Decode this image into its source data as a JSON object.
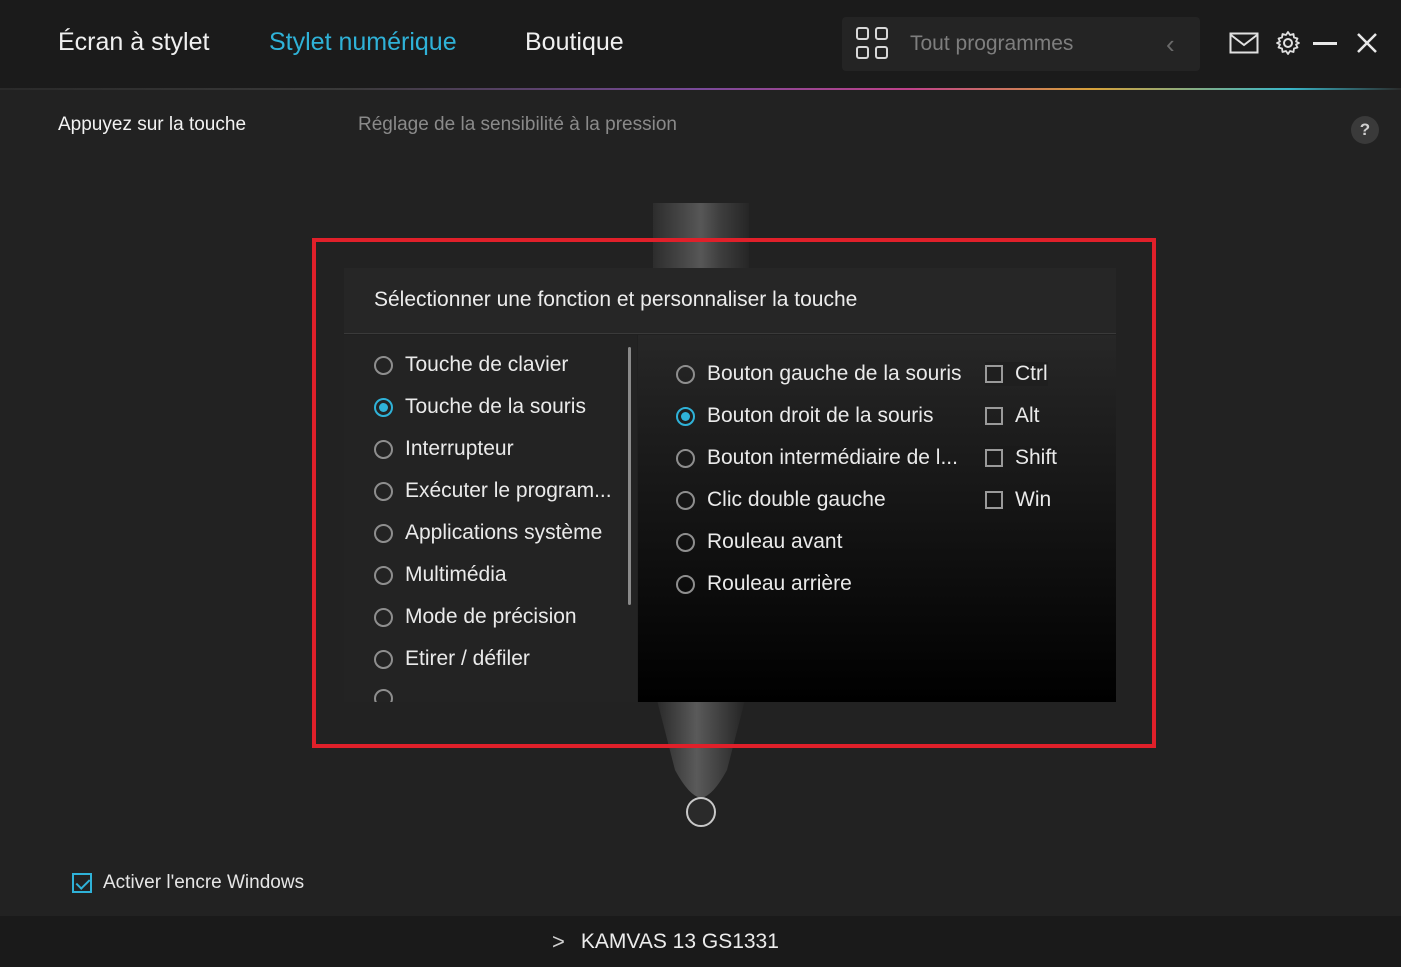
{
  "header": {
    "tabs": [
      {
        "label": "Écran à stylet",
        "active": false
      },
      {
        "label": "Stylet numérique",
        "active": true
      },
      {
        "label": "Boutique",
        "active": false
      }
    ],
    "program_selector": {
      "label": "Tout programmes",
      "icon": "grid-icon"
    },
    "window_icons": [
      "mail-icon",
      "gear-icon",
      "minimize-icon",
      "close-icon"
    ],
    "accent_color": "#2fb2d8"
  },
  "subtabs": {
    "active": "Appuyez sur la touche",
    "inactive": "Réglage de la sensibilité à la pression",
    "help": "?"
  },
  "panel": {
    "title": "Sélectionner une fonction et personnaliser la touche",
    "categories": [
      {
        "label": "Touche de clavier",
        "selected": false
      },
      {
        "label": "Touche de la souris",
        "selected": true
      },
      {
        "label": "Interrupteur",
        "selected": false
      },
      {
        "label": "Exécuter le program...",
        "selected": false
      },
      {
        "label": "Applications système",
        "selected": false
      },
      {
        "label": "Multimédia",
        "selected": false
      },
      {
        "label": "Mode de précision",
        "selected": false
      },
      {
        "label": "Etirer / défiler",
        "selected": false
      }
    ],
    "mouse_functions": [
      {
        "label": "Bouton gauche de la souris",
        "selected": false
      },
      {
        "label": "Bouton droit de la souris",
        "selected": true
      },
      {
        "label": "Bouton intermédiaire de l...",
        "selected": false
      },
      {
        "label": "Clic double gauche",
        "selected": false
      },
      {
        "label": "Rouleau avant",
        "selected": false
      },
      {
        "label": "Rouleau arrière",
        "selected": false
      }
    ],
    "modifiers": [
      {
        "label": "Ctrl",
        "checked": false
      },
      {
        "label": "Alt",
        "checked": false
      },
      {
        "label": "Shift",
        "checked": false
      },
      {
        "label": "Win",
        "checked": false
      }
    ]
  },
  "footer": {
    "windows_ink": {
      "label": "Activer l'encre Windows",
      "checked": true
    },
    "device": "KAMVAS 13 GS1331"
  }
}
